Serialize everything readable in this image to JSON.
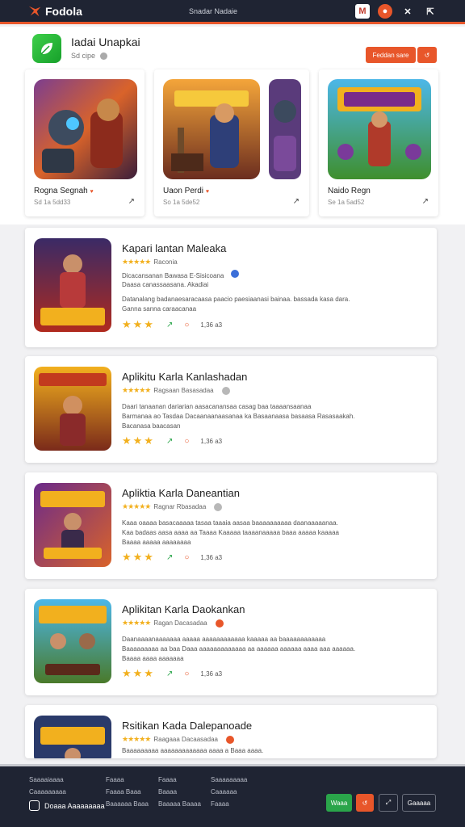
{
  "topbar": {
    "brand": "Fodola",
    "center": "Snadar Nadaie",
    "icons": [
      "m-icon",
      "fire-icon",
      "close-icon",
      "expand-icon"
    ]
  },
  "hero": {
    "title": "Iadai Unapkai",
    "subtitle": "Sd cipe",
    "primary_button": "Feddan sare",
    "secondary_button": "↺",
    "featured": [
      {
        "name": "Rogna Segnah",
        "meta": "Sd 1a 5dd33"
      },
      {
        "name": "Uaon Perdi",
        "meta": "So 1a 5de52"
      },
      {
        "name": "Naido Regn",
        "meta": "Se 1a 5ad52"
      }
    ]
  },
  "apps": [
    {
      "title": "Kapari lantan Maleaka",
      "rating_label": "Raconia",
      "lines": [
        "Dicacansanan Bawasa E-Sisicoana",
        "Daasa canassaasana. Akadiai",
        "Datanalang badanaesaracaasa paacio paesiaanasi bainaa. bassada kasa dara.",
        "Ganna sanna caraacanaa"
      ],
      "count": "1,36 a3"
    },
    {
      "title": "Aplikitu Karla Kanlashadan",
      "rating_label": "Ragsaan Basasadaa",
      "lines": [
        "Daari tanaanan dariarian aasacanansaa casag baa taaaansaanaa",
        "Barmanaa ao Tasdaa Dacaanaanaasanaa ka Basaanaasa basaasa Rasasaakah.",
        "Bacanasa baacasan"
      ],
      "count": "1,36 a3"
    },
    {
      "title": "Apliktia Karla Daneantian",
      "rating_label": "Ragnar Rbasadaa",
      "lines": [
        "Kaaa oaaaa basacaaaaa tasaa taaaia aasaa baaaaaaaaaa daanaaaaanaa.",
        "Kaa badaas aasa aaaa aa Taaaa Kaaaaa taaaanaaaaa baaa aaaaa kaaaaa",
        "Baaaa aaaaa aaaaaaaa"
      ],
      "count": "1,36 a3"
    },
    {
      "title": "Aplikitan Karla Daokankan",
      "rating_label": "Ragan Dacasadaa",
      "lines": [
        "Daanaaaanaaaaaaa aaaaa aaaaaaaaaaaa kaaaaa aa baaaaaaaaaaaa",
        "Baaaaaaaaa aa baa Daaa aaaaaaaaaaaaa aa aaaaaa aaaaaa aaaa aaa aaaaaa.",
        "Baaaa aaaa aaaaaaa"
      ],
      "count": "1,36 a3"
    },
    {
      "title": "Rsitikan Kada Dalepanoade",
      "rating_label": "Raagaaa Dacaasadaa",
      "lines": [
        "Baaaaaaaaa aaaaaaaaaaaaa aaaa a Baaa aaaa."
      ],
      "count": ""
    }
  ],
  "footer": {
    "col1": [
      "Saaaaiaaaa",
      "Caaaaaaaaa"
    ],
    "col2": [
      "Faaaa",
      "Faaaa Baaa",
      "Baaaaaa Baaa"
    ],
    "col3": [
      "Faaaa",
      "Baaaa",
      "Baaaaa Baaaa"
    ],
    "col4": [
      "Saaaaaaaaa",
      "Caaaaaa",
      "Faaaa"
    ],
    "brand": "Doaaa Aaaaaaaaa",
    "buttons": {
      "green": "Waaa",
      "orange": "↺",
      "dark1": "⤢",
      "dark2": "Gaaaaa"
    }
  },
  "colors": {
    "accent": "#e8562a",
    "nav": "#1f2433",
    "green": "#2aa54a",
    "star": "#f2b01e"
  }
}
